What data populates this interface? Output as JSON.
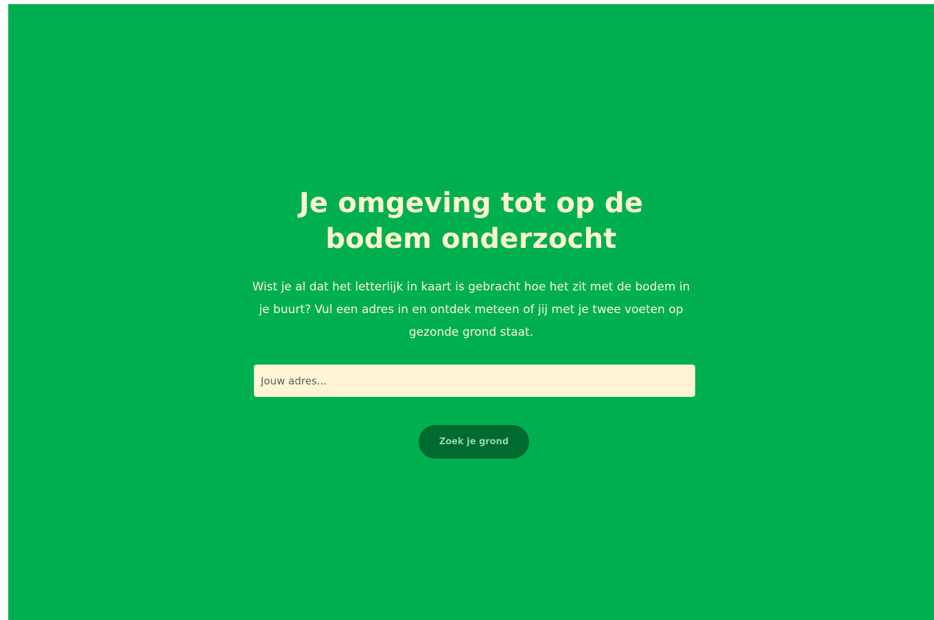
{
  "hero": {
    "title": "Je omgeving tot op de bodem onderzocht",
    "intro": "Wist je al dat het letterlijk in kaart is gebracht hoe het zit met de bodem in je buurt? Vul een adres in en ontdek meteen of jij met je twee voeten op gezonde grond staat.",
    "background_color": "#00b050",
    "text_color": "#fff5cc"
  },
  "search": {
    "placeholder": "Jouw adres...",
    "value": "",
    "button_label": "Zoek je grond",
    "field_color": "#fff5d4",
    "button_color": "#006b2e"
  }
}
